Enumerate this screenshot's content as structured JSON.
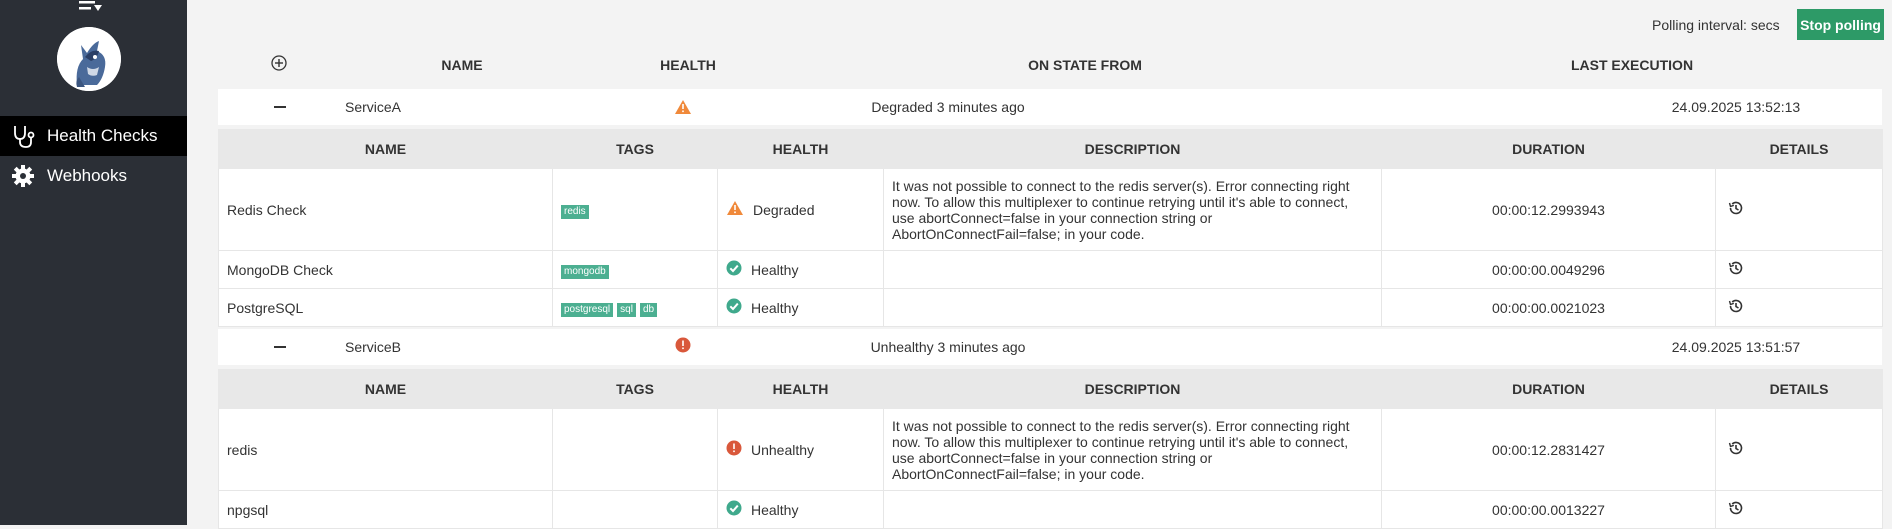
{
  "sidebar": {
    "items": [
      {
        "label": "Health Checks",
        "icon": "stethoscope-icon"
      },
      {
        "label": "Webhooks",
        "icon": "gear-icon"
      }
    ]
  },
  "topbar": {
    "polling_label": "Polling interval: secs",
    "stop_button": "Stop polling"
  },
  "table": {
    "headers": {
      "name": "NAME",
      "health": "HEALTH",
      "on_state_from": "ON STATE FROM",
      "last_execution": "LAST EXECUTION"
    },
    "sub_headers": {
      "name": "NAME",
      "tags": "TAGS",
      "health": "HEALTH",
      "description": "DESCRIPTION",
      "duration": "DURATION",
      "details": "DETAILS"
    }
  },
  "services": [
    {
      "name": "ServiceA",
      "state": "Degraded 3 minutes ago",
      "last_execution": "24.09.2025 13:52:13",
      "checks": [
        {
          "name": "Redis Check",
          "tags": [
            "redis"
          ],
          "health": "Degraded",
          "description": "It was not possible to connect to the redis server(s). Error connecting right now. To allow this multiplexer to continue retrying until it's able to connect, use abortConnect=false in your connection string or AbortOnConnectFail=false; in your code.",
          "duration": "00:00:12.2993943"
        },
        {
          "name": "MongoDB Check",
          "tags": [
            "mongodb"
          ],
          "health": "Healthy",
          "description": "",
          "duration": "00:00:00.0049296"
        },
        {
          "name": "PostgreSQL",
          "tags": [
            "postgresql",
            "sql",
            "db"
          ],
          "health": "Healthy",
          "description": "",
          "duration": "00:00:00.0021023"
        }
      ]
    },
    {
      "name": "ServiceB",
      "state": "Unhealthy 3 minutes ago",
      "last_execution": "24.09.2025 13:51:57",
      "checks": [
        {
          "name": "redis",
          "tags": [],
          "health": "Unhealthy",
          "description": "It was not possible to connect to the redis server(s). Error connecting right now. To allow this multiplexer to continue retrying until it's able to connect, use abortConnect=false in your connection string or AbortOnConnectFail=false; in your code.",
          "duration": "00:00:12.2831427"
        },
        {
          "name": "npgsql",
          "tags": [],
          "health": "Healthy",
          "description": "",
          "duration": "00:00:00.0013227"
        }
      ]
    }
  ],
  "colors": {
    "sidebar": "#2b2f36",
    "accent": "#2d9a67",
    "degraded": "#f0893a",
    "healthy": "#3fa98c",
    "unhealthy": "#d9583b",
    "tag": "#4caf91"
  }
}
